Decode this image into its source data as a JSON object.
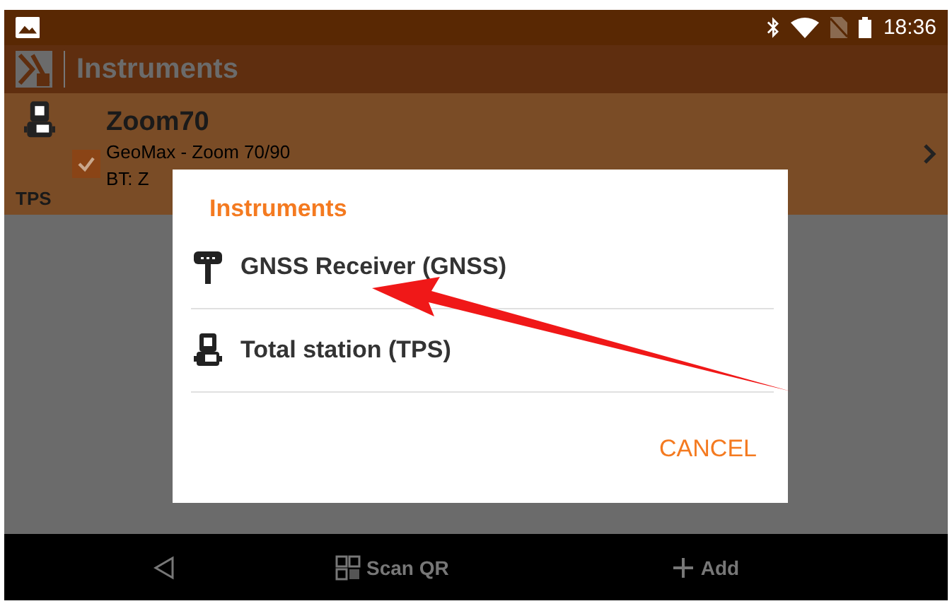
{
  "status_bar": {
    "time": "18:36"
  },
  "toolbar": {
    "title": "Instruments"
  },
  "instruments": [
    {
      "type_label": "TPS",
      "name": "Zoom70",
      "model": "GeoMax - Zoom 70/90",
      "connection": "BT: Z",
      "checked": true
    }
  ],
  "dialog": {
    "title": "Instruments",
    "options": [
      {
        "kind": "gnss",
        "label": "GNSS Receiver (GNSS)"
      },
      {
        "kind": "tps",
        "label": "Total station (TPS)"
      }
    ],
    "button": "CANCEL"
  },
  "bottom_bar": {
    "scan": "Scan QR",
    "add": "Add"
  }
}
